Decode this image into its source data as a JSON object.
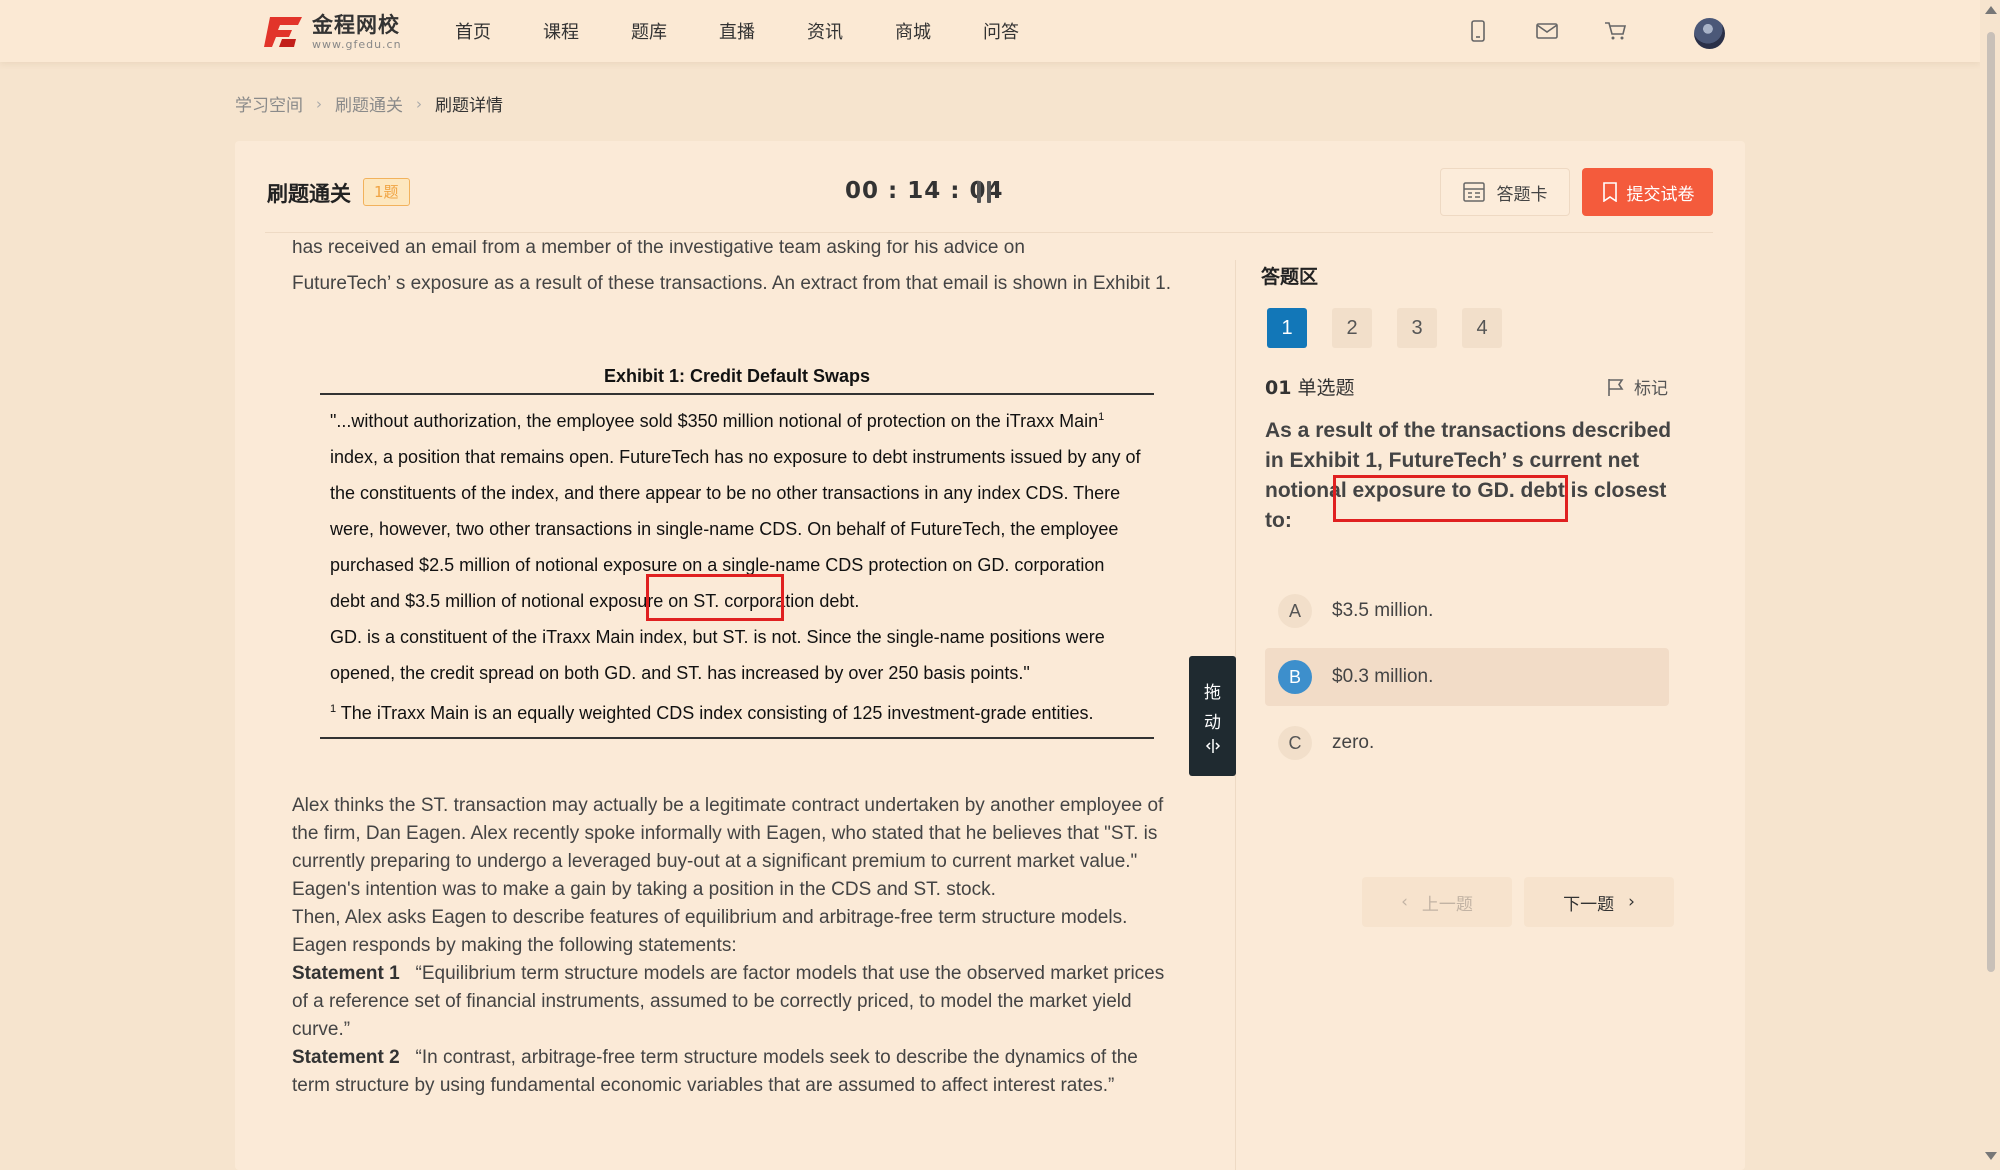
{
  "logo": {
    "name": "金程网校",
    "sub": "www.gfedu.cn"
  },
  "nav": [
    "首页",
    "课程",
    "题库",
    "直播",
    "资讯",
    "商城",
    "问答"
  ],
  "breadcrumb": [
    "学习空间",
    "刷题通关",
    "刷题详情"
  ],
  "header": {
    "title": "刷题通关",
    "count": "1题",
    "timer": "00 : 14 : 04",
    "answer_card": "答题卡",
    "submit": "提交试卷"
  },
  "passage": {
    "top_cut": "has received an email from a member of the investigative team asking for his advice on",
    "intro": "FutureTech’ s exposure as a result of these transactions. An extract from that email is shown in Exhibit 1.",
    "exhibit_title": "Exhibit 1: Credit Default Swaps",
    "exhibit_p1a": "\"...without authorization, the employee sold $350 million notional of protection on the iTraxx Main",
    "exhibit_p1_sup": "1",
    "exhibit_p1b": " index, a position that remains open. FutureTech has no exposure to debt instruments issued by any of the constituents of the index, and there appear to be no other transactions in any index CDS. There were, however, two other transactions in single-name CDS. On behalf of FutureTech, the employee purchased $2.5 million of notional exposure on a single-name CDS protection on GD. corporation debt and $3.5 million of notional exposure on ST. corporation debt.",
    "exhibit_p2": "GD. is a constituent of the iTraxx Main index, but ST. is not. Since the single-name positions were opened, the credit spread on both GD. and ST. has increased by over 250 basis points.\"",
    "footnote_sup": "1",
    "footnote": " The iTraxx Main is an equally weighted CDS index consisting of 125 investment-grade entities.",
    "p_alex": "Alex thinks the ST. transaction may actually be a legitimate contract undertaken by another employee of the firm, Dan Eagen. Alex recently spoke informally with Eagen, who stated that he believes that \"ST. is currently preparing to undergo a leveraged buy-out at a significant premium to current market value.\" Eagen's intention was to make a gain by taking a position in the CDS and ST. stock.",
    "p_then": "Then, Alex asks Eagen to describe features of equilibrium and arbitrage-free term structure models. Eagen responds by making the following statements:",
    "s1_label": "Statement 1",
    "s1_text": "“Equilibrium term structure models are factor models that use the observed market prices of a reference set of financial instruments, assumed to be correctly priced, to model the market yield curve.”",
    "s2_label": "Statement 2",
    "s2_text": "“In contrast, arbitrage-free term structure models seek to describe the dynamics of the term structure by using fundamental economic variables that are assumed to affect interest rates.”"
  },
  "drag": [
    "拖",
    "动"
  ],
  "answer_area": {
    "title": "答题区",
    "question_numbers": [
      "1",
      "2",
      "3",
      "4"
    ],
    "q_index": "01",
    "q_type": "单选题",
    "mark_label": "标记",
    "question": "As a result of the transactions described in Exhibit 1, FutureTech’ s current net notional exposure to GD. debt is closest to:",
    "options": [
      {
        "letter": "A",
        "text": "$3.5 million."
      },
      {
        "letter": "B",
        "text": "$0.3 million."
      },
      {
        "letter": "C",
        "text": "zero."
      }
    ],
    "selected": "B",
    "prev": "上一题",
    "next": "下一题"
  },
  "colors": {
    "accent": "#f45b3c",
    "active": "#1277b8",
    "selected_option": "#3d8fcc",
    "highlight": "#e02020"
  }
}
